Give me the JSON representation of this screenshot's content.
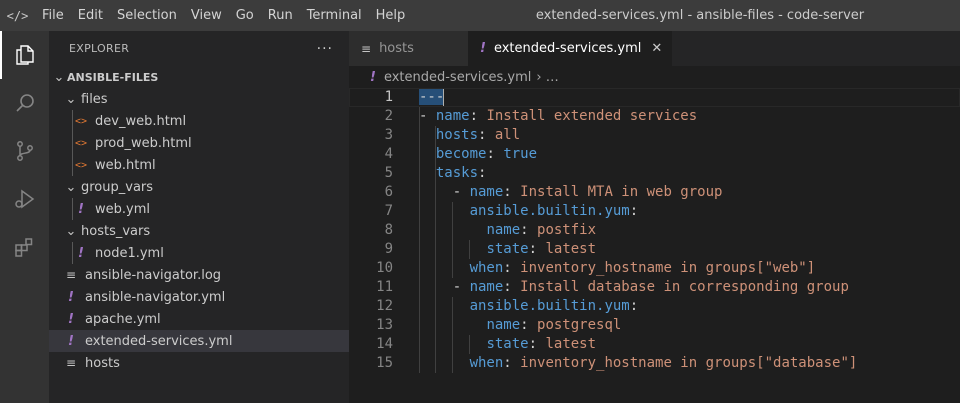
{
  "window": {
    "title": "extended-services.yml - ansible-files - code-server"
  },
  "menu": [
    "File",
    "Edit",
    "Selection",
    "View",
    "Go",
    "Run",
    "Terminal",
    "Help"
  ],
  "activity_bar": [
    "explorer-icon",
    "search-icon",
    "source-control-icon",
    "run-debug-icon",
    "extensions-icon"
  ],
  "sidebar": {
    "title": "EXPLORER",
    "more": "···",
    "root": "ANSIBLE-FILES",
    "tree": [
      {
        "label": "files",
        "type": "folder",
        "depth": 1
      },
      {
        "label": "dev_web.html",
        "type": "html",
        "depth": 2
      },
      {
        "label": "prod_web.html",
        "type": "html",
        "depth": 2
      },
      {
        "label": "web.html",
        "type": "html",
        "depth": 2
      },
      {
        "label": "group_vars",
        "type": "folder",
        "depth": 1
      },
      {
        "label": "web.yml",
        "type": "yml",
        "depth": 2
      },
      {
        "label": "hosts_vars",
        "type": "folder",
        "depth": 1
      },
      {
        "label": "node1.yml",
        "type": "yml",
        "depth": 2
      },
      {
        "label": "ansible-navigator.log",
        "type": "txt",
        "depth": 1
      },
      {
        "label": "ansible-navigator.yml",
        "type": "yml",
        "depth": 1
      },
      {
        "label": "apache.yml",
        "type": "yml",
        "depth": 1
      },
      {
        "label": "extended-services.yml",
        "type": "yml",
        "depth": 1,
        "selected": true
      },
      {
        "label": "hosts",
        "type": "txt",
        "depth": 1
      }
    ]
  },
  "tabs": [
    {
      "label": "hosts",
      "active": false
    },
    {
      "label": "extended-services.yml",
      "active": true,
      "close": "✕"
    }
  ],
  "breadcrumb": {
    "file": "extended-services.yml",
    "rest": "› …"
  },
  "code": {
    "lines": [
      "---",
      "- name: Install extended services",
      "  hosts: all",
      "  become: true",
      "  tasks:",
      "    - name: Install MTA in web group",
      "      ansible.builtin.yum:",
      "        name: postfix",
      "        state: latest",
      "      when: inventory_hostname in groups[\"web\"]",
      "    - name: Install database in corresponding group",
      "      ansible.builtin.yum:",
      "        name: postgresql",
      "        state: latest",
      "      when: inventory_hostname in groups[\"database\"]"
    ],
    "current_line": 1
  }
}
